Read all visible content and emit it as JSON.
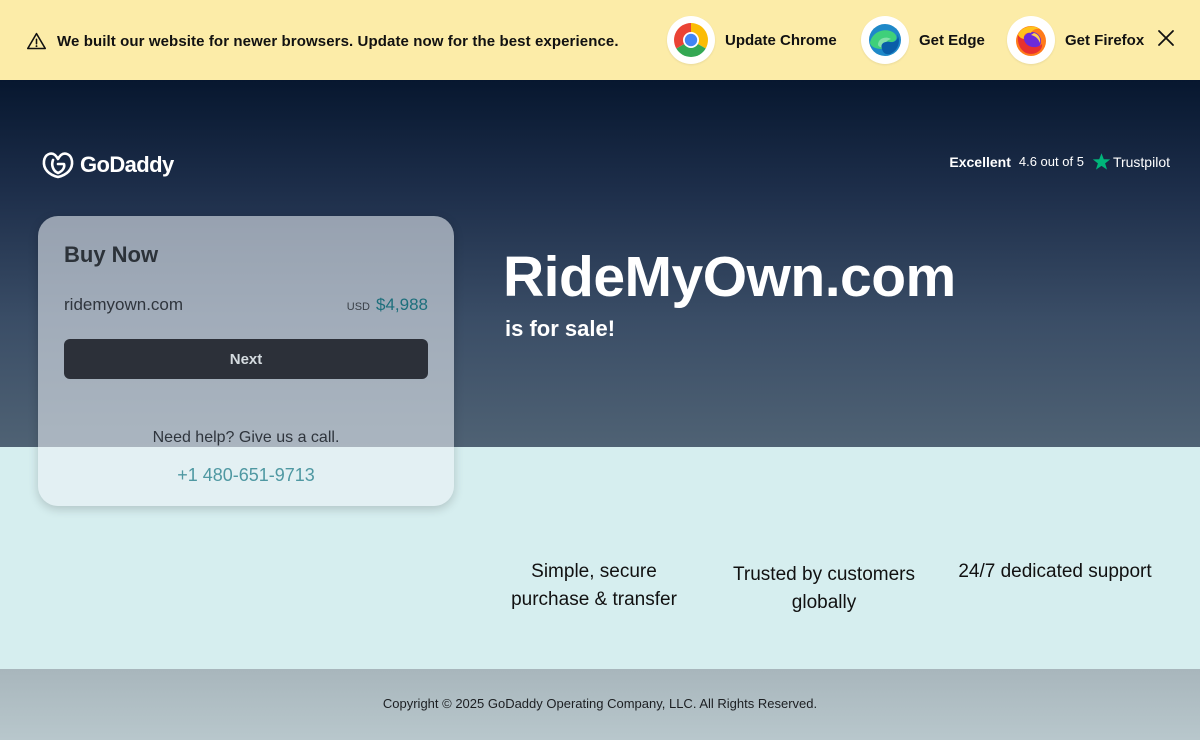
{
  "banner": {
    "message": "We built our website for newer browsers. Update now for the best experience.",
    "browsers": [
      {
        "label": "Update Chrome",
        "icon": "chrome-icon"
      },
      {
        "label": "Get Edge",
        "icon": "edge-icon"
      },
      {
        "label": "Get Firefox",
        "icon": "firefox-icon"
      }
    ],
    "close_icon": "close-icon"
  },
  "header": {
    "logo_text": "GoDaddy",
    "trust": {
      "rating_label": "Excellent",
      "score": "4.6 out of 5",
      "brand": "Trustpilot",
      "star_color": "#00b67a"
    }
  },
  "hero": {
    "domain_title": "RideMyOwn.com",
    "subtitle": "is for sale!"
  },
  "buy_card": {
    "title": "Buy Now",
    "domain": "ridemyown.com",
    "currency": "USD",
    "price": "$4,988",
    "next_label": "Next",
    "help_text": "Need help? Give us a call.",
    "phone": "+1 480-651-9713"
  },
  "features": [
    {
      "line1": "Simple, secure",
      "line2": "purchase & transfer"
    },
    {
      "line1": "Trusted by customers",
      "line2": "globally"
    },
    {
      "line1": "24/7 dedicated support",
      "line2": ""
    }
  ],
  "footer": {
    "copyright": "Copyright © 2025 GoDaddy Operating Company, LLC. All Rights Reserved."
  },
  "colors": {
    "banner_bg": "#fceca8",
    "hero_top": "#07172f",
    "hero_bottom": "#4f6274",
    "lower_bg": "#d6eeef",
    "price_accent": "#1d6f7c",
    "button_bg": "#2c3039"
  }
}
